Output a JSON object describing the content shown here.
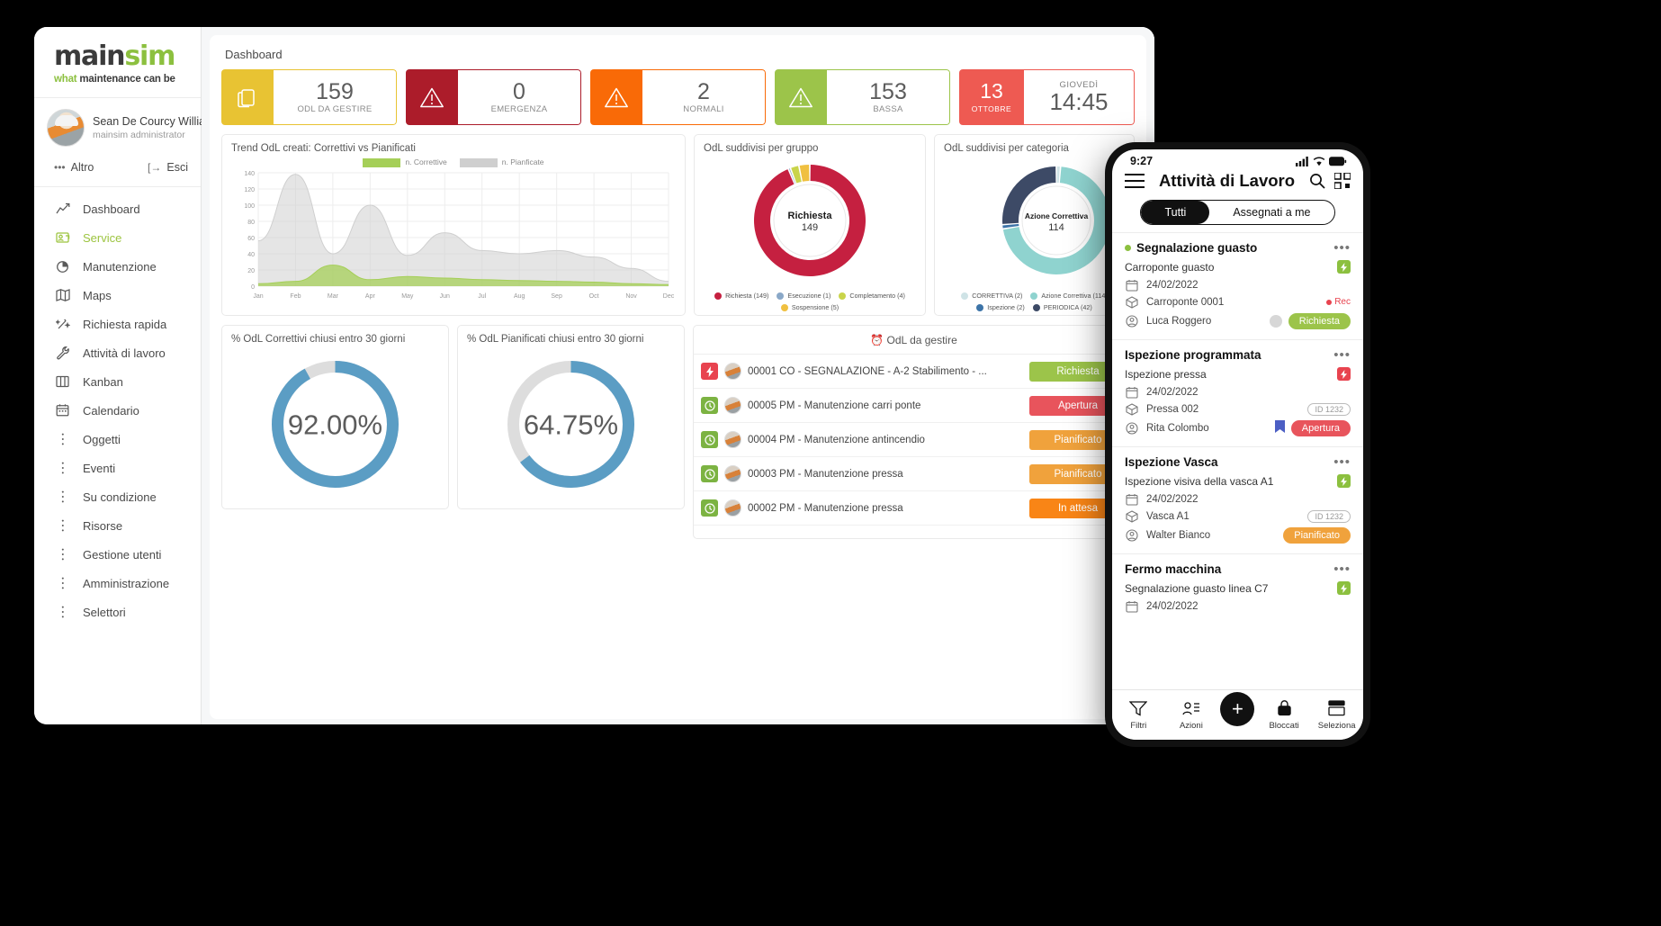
{
  "sidebar": {
    "logo": {
      "main_dark": "main",
      "main_green": "sim",
      "sub_green": "what",
      "sub_dark": "maintenance can be"
    },
    "user": {
      "name": "Sean De Courcy Willia",
      "role": "mainsim administrator"
    },
    "altro_label": "Altro",
    "esci_label": "Esci",
    "items": [
      {
        "label": "Dashboard",
        "icon": "chart-line-icon",
        "active": false
      },
      {
        "label": "Service",
        "icon": "service-icon",
        "active": true
      },
      {
        "label": "Manutenzione",
        "icon": "pie-chart-icon",
        "active": false
      },
      {
        "label": "Maps",
        "icon": "map-icon",
        "active": false
      },
      {
        "label": "Richiesta rapida",
        "icon": "magic-wand-icon",
        "active": false
      },
      {
        "label": "Attività di lavoro",
        "icon": "wrench-icon",
        "active": false
      },
      {
        "label": "Kanban",
        "icon": "kanban-icon",
        "active": false
      },
      {
        "label": "Calendario",
        "icon": "calendar-icon",
        "active": false
      },
      {
        "label": "Oggetti",
        "icon": "dots-vertical-icon",
        "active": false
      },
      {
        "label": "Eventi",
        "icon": "dots-vertical-icon",
        "active": false
      },
      {
        "label": "Su condizione",
        "icon": "dots-vertical-icon",
        "active": false
      },
      {
        "label": "Risorse",
        "icon": "dots-vertical-icon",
        "active": false
      },
      {
        "label": "Gestione utenti",
        "icon": "dots-vertical-icon",
        "active": false
      },
      {
        "label": "Amministrazione",
        "icon": "dots-vertical-icon",
        "active": false
      },
      {
        "label": "Selettori",
        "icon": "dots-vertical-icon",
        "active": false
      }
    ]
  },
  "main": {
    "page_title": "Dashboard",
    "kpis": [
      {
        "value": "159",
        "label": "ODL DA GESTIRE",
        "color": "#e8c333",
        "icon": "clipboard-icon"
      },
      {
        "value": "0",
        "label": "EMERGENZA",
        "color": "#ac1c2a",
        "icon": "warning-triangle-icon"
      },
      {
        "value": "2",
        "label": "NORMALI",
        "color": "#f96a07",
        "icon": "warning-triangle-icon"
      },
      {
        "value": "153",
        "label": "BASSA",
        "color": "#9cc44a",
        "icon": "warning-triangle-icon"
      }
    ],
    "date_card": {
      "day_num": "13",
      "month": "OTTOBRE",
      "weekday": "GIOVEDÌ",
      "time": "14:45",
      "color": "#ee5a52"
    }
  },
  "chart_data": [
    {
      "type": "area",
      "title": "Trend OdL creati: Correttivi vs Pianificati",
      "categories": [
        "Jan",
        "Feb",
        "Mar",
        "Apr",
        "May",
        "Jun",
        "Jul",
        "Aug",
        "Sep",
        "Oct",
        "Nov",
        "Dec"
      ],
      "series": [
        {
          "name": "n. Correttive",
          "color": "#a5cf58",
          "values": [
            3,
            6,
            26,
            8,
            12,
            10,
            8,
            7,
            6,
            5,
            3,
            2
          ]
        },
        {
          "name": "n. Pianificate",
          "color": "#cfcfcf",
          "values": [
            56,
            138,
            40,
            100,
            38,
            66,
            44,
            40,
            44,
            36,
            22,
            6
          ]
        }
      ],
      "ylabel": "",
      "xlabel": "",
      "yticks": [
        0,
        20,
        40,
        60,
        80,
        100,
        120,
        140
      ],
      "ylim": [
        0,
        140
      ],
      "grid": true,
      "legend_position": "top"
    },
    {
      "type": "pie",
      "title": "OdL suddivisi per gruppo",
      "center_label": "Richiesta",
      "center_value": "149",
      "labels": [
        "Richiesta (149)",
        "Esecuzione (1)",
        "Completamento (4)",
        "Sospensione (5)"
      ],
      "values": [
        149,
        1,
        4,
        5
      ],
      "colors": [
        "#c52040",
        "#8aa8c8",
        "#c9d44a",
        "#f0c040"
      ],
      "legend_position": "bottom"
    },
    {
      "type": "pie",
      "title": "OdL suddivisi per categoria",
      "center_label": "Azione Correttiva",
      "center_value": "114",
      "labels": [
        "CORRETTIVA (2)",
        "Azione Correttiva (114)",
        "Ispezione (2)",
        "PERIODICA (42)"
      ],
      "values": [
        2,
        114,
        2,
        42
      ],
      "colors": [
        "#cfe3e6",
        "#8fd3cf",
        "#3d74a8",
        "#3d4a66"
      ],
      "legend_position": "bottom"
    },
    {
      "type": "pie",
      "title": "% OdL Correttivi chiusi entro 30 giorni",
      "center_value": "92.00%",
      "values": [
        92,
        8
      ],
      "colors": [
        "#5b9dc4",
        "#dddddd"
      ]
    },
    {
      "type": "pie",
      "title": "% OdL Pianificati chiusi entro 30 giorni",
      "center_value": "64.75%",
      "values": [
        64.75,
        35.25
      ],
      "colors": [
        "#5b9dc4",
        "#dddddd"
      ]
    }
  ],
  "odl_panel": {
    "header": "OdL da gestire",
    "rows": [
      {
        "sq_color": "#e8434f",
        "sq_icon": "bolt-icon",
        "text": "00001 CO - SEGNALAZIONE - A-2 Stabilimento - ...",
        "badge": "Richiesta",
        "badge_color": "#9cc44a"
      },
      {
        "sq_color": "#7cb342",
        "sq_icon": "clock-icon",
        "text": "00005 PM - Manutenzione carri ponte",
        "badge": "Apertura",
        "badge_color": "#e8545c"
      },
      {
        "sq_color": "#7cb342",
        "sq_icon": "clock-icon",
        "text": "00004 PM - Manutenzione antincendio",
        "badge": "Pianificato",
        "badge_color": "#f0a23c"
      },
      {
        "sq_color": "#7cb342",
        "sq_icon": "clock-icon",
        "text": "00003 PM - Manutenzione pressa",
        "badge": "Pianificato",
        "badge_color": "#f0a23c"
      },
      {
        "sq_color": "#7cb342",
        "sq_icon": "clock-icon",
        "text": "00002 PM - Manutenzione pressa",
        "badge": "In attesa",
        "badge_color": "#f98516"
      }
    ]
  },
  "phone": {
    "status": {
      "time": "9:27",
      "signal": "signal-icon",
      "wifi": "wifi-icon",
      "battery": "battery-icon"
    },
    "menu_icon": "hamburger-menu-icon",
    "title": "Attività di Lavoro",
    "search_icon": "search-icon",
    "qr_icon": "qr-code-icon",
    "tabs": [
      {
        "label": "Tutti",
        "active": true
      },
      {
        "label": "Assegnati a me",
        "active": false
      }
    ],
    "cards": [
      {
        "title": "Segnalazione guasto",
        "has_bullet": true,
        "subtitle": "Carroponte guasto",
        "flag_color": "#8cc03f",
        "date": "24/02/2022",
        "asset": "Carroponte 0001",
        "person": "Luca Roggero",
        "right_asset": "Rec",
        "right_asset_type": "rec",
        "badge": "Richiesta",
        "badge_color": "#9cc44a",
        "avatar_right": true
      },
      {
        "title": "Ispezione programmata",
        "has_bullet": false,
        "subtitle": "Ispezione pressa",
        "flag_color": "#e8434f",
        "date": "24/02/2022",
        "asset": "Pressa 002",
        "person": "Rita Colombo",
        "right_asset": "ID 1232",
        "right_asset_type": "pill",
        "badge": "Apertura",
        "badge_color": "#e8545c",
        "bookmark": true
      },
      {
        "title": "Ispezione Vasca",
        "has_bullet": false,
        "subtitle": "Ispezione visiva della vasca A1",
        "flag_color": "#8cc03f",
        "date": "24/02/2022",
        "asset": "Vasca A1",
        "person": "Walter Bianco",
        "right_asset": "ID 1232",
        "right_asset_type": "pill",
        "badge": "Pianificato",
        "badge_color": "#f0a23c"
      },
      {
        "title": "Fermo macchina",
        "has_bullet": false,
        "subtitle": "Segnalazione guasto linea C7",
        "flag_color": "#8cc03f",
        "date": "24/02/2022",
        "asset": "",
        "person": "",
        "right_asset": "",
        "right_asset_type": "none",
        "badge": "",
        "badge_color": "#ffffff"
      }
    ],
    "nav": [
      {
        "label": "Filtri",
        "icon": "filter-icon"
      },
      {
        "label": "Azioni",
        "icon": "actions-icon"
      },
      {
        "label": "add",
        "icon": "plus-icon"
      },
      {
        "label": "Bloccati",
        "icon": "lock-icon"
      },
      {
        "label": "Seleziona",
        "icon": "select-icon"
      }
    ]
  }
}
